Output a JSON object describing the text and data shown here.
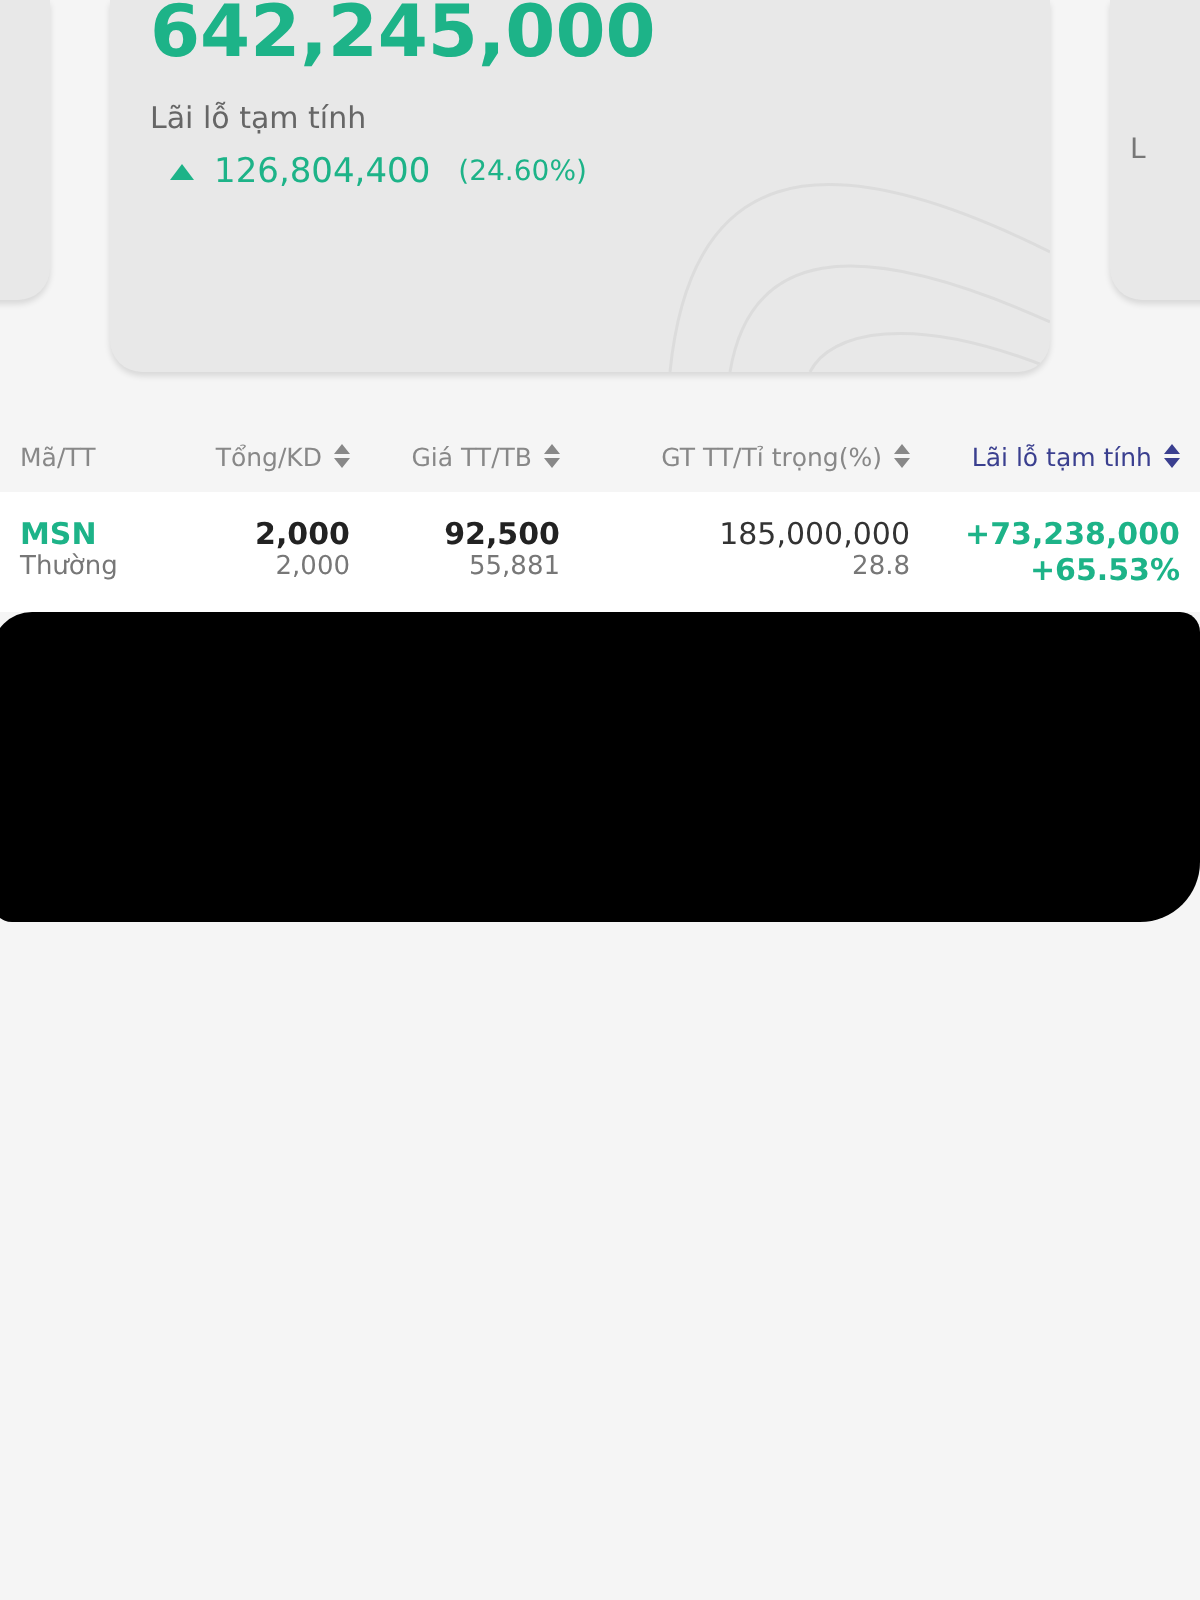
{
  "summary_card": {
    "total_value": "642,245,000",
    "pnl_label": "Lãi lỗ tạm tính",
    "pnl_positive": true,
    "pnl_value": "126,804,400",
    "pnl_percent": "(24.60%)"
  },
  "side_card_right": {
    "label": "L"
  },
  "table": {
    "columns": [
      {
        "label": "Mã/TT",
        "sortable": false,
        "selected": false
      },
      {
        "label": "Tổng/KD",
        "sortable": true,
        "selected": false
      },
      {
        "label": "Giá TT/TB",
        "sortable": true,
        "selected": false
      },
      {
        "label": "GT TT/Tỉ trọng(%)",
        "sortable": true,
        "selected": false
      },
      {
        "label": "Lãi lỗ tạm tính",
        "sortable": true,
        "selected": true
      }
    ],
    "rows": [
      {
        "symbol": "MSN",
        "type": "Thường",
        "total": "2,000",
        "available": "2,000",
        "price": "92,500",
        "avg_price": "55,881",
        "market_value": "185,000,000",
        "weight": "28.8",
        "pnl": "+73,238,000",
        "pnl_percent": "+65.53%",
        "positive": true
      }
    ]
  },
  "redaction": {
    "shown": true
  }
}
